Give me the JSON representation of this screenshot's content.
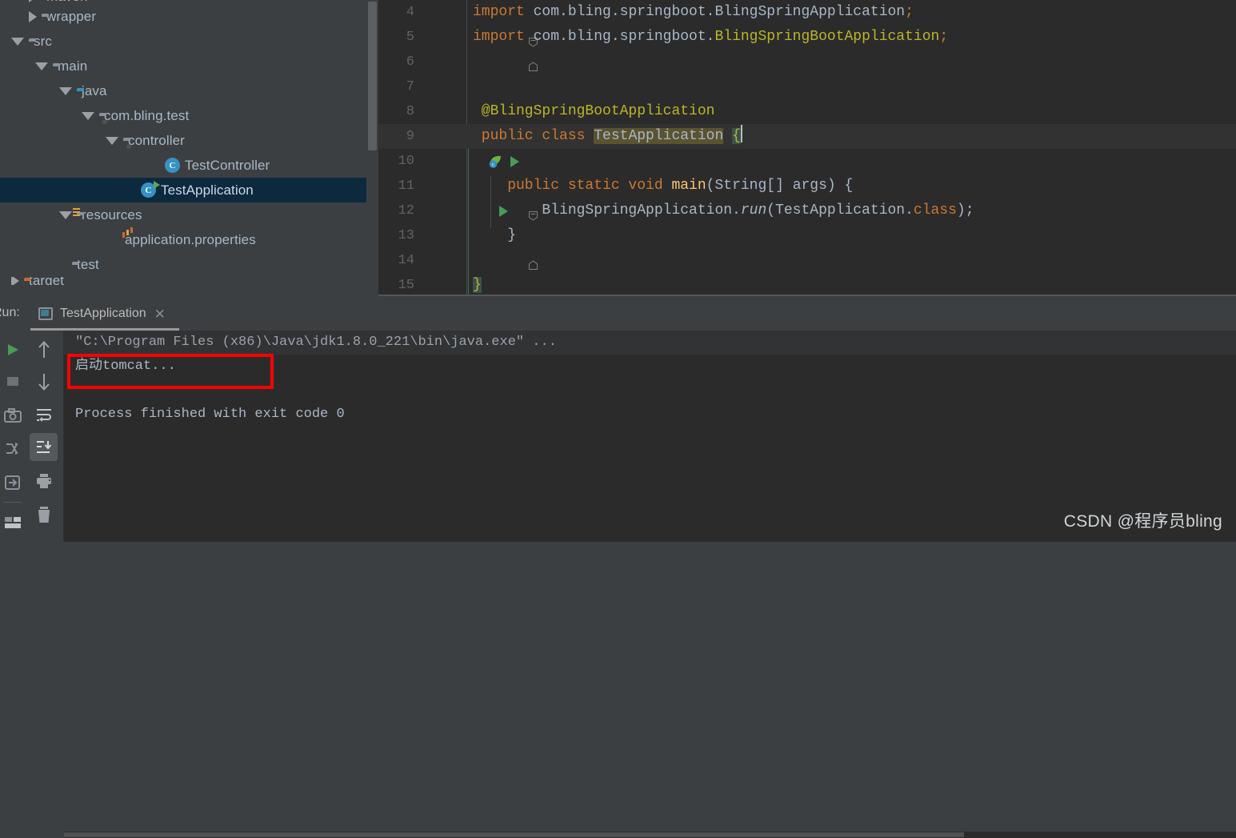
{
  "project_tree": {
    "items": [
      {
        "label": "maven",
        "indent": 1,
        "twisty": "collapsed",
        "icon": "folder",
        "selected": false,
        "partial": "top"
      },
      {
        "label": "wrapper",
        "indent": 2,
        "twisty": "collapsed",
        "icon": "folder",
        "selected": false
      },
      {
        "label": "src",
        "indent": 1,
        "twisty": "expanded",
        "icon": "folder",
        "selected": false
      },
      {
        "label": "main",
        "indent": 2,
        "twisty": "expanded",
        "icon": "folder",
        "selected": false
      },
      {
        "label": "java",
        "indent": 3,
        "twisty": "expanded",
        "icon": "folder-blue",
        "selected": false
      },
      {
        "label": "com.bling.test",
        "indent": 4,
        "twisty": "expanded",
        "icon": "folder-package",
        "selected": false
      },
      {
        "label": "controller",
        "indent": 5,
        "twisty": "expanded",
        "icon": "folder-package",
        "selected": false
      },
      {
        "label": "TestController",
        "indent": 6,
        "twisty": "none",
        "icon": "java-class",
        "selected": false
      },
      {
        "label": "TestApplication",
        "indent": 6,
        "twisty": "none",
        "icon": "java-class-runnable",
        "selected": true
      },
      {
        "label": "resources",
        "indent": 3,
        "twisty": "expanded",
        "icon": "folder-resources",
        "selected": false
      },
      {
        "label": "application.properties",
        "indent": 4,
        "twisty": "none",
        "icon": "properties-file",
        "selected": false
      },
      {
        "label": "test",
        "indent": 3,
        "twisty": "none",
        "icon": "folder",
        "selected": false
      },
      {
        "label": "target",
        "indent": 1,
        "twisty": "collapsed",
        "icon": "folder-orange",
        "selected": false,
        "partial": "bottom"
      }
    ]
  },
  "editor": {
    "lines": [
      {
        "num": "4",
        "fold": "minus",
        "gutter": "",
        "segments": [
          {
            "text": "import ",
            "style": "kw"
          },
          {
            "text": "com.bling.springboot.BlingSpringApplication",
            "style": "id"
          },
          {
            "text": ";",
            "style": "kw"
          }
        ]
      },
      {
        "num": "5",
        "fold": "end",
        "gutter": "",
        "segments": [
          {
            "text": "import ",
            "style": "kw"
          },
          {
            "text": "com.bling.springboot.",
            "style": "id"
          },
          {
            "text": "BlingSpringBootApplication",
            "style": "ann"
          },
          {
            "text": ";",
            "style": "kw"
          }
        ]
      },
      {
        "num": "6",
        "fold": "",
        "gutter": "",
        "segments": []
      },
      {
        "num": "7",
        "fold": "",
        "gutter": "",
        "segments": []
      },
      {
        "num": "8",
        "fold": "",
        "gutter": "spring-bean-icon",
        "segments": [
          {
            "text": " @BlingSpringBootApplication",
            "style": "ann"
          }
        ]
      },
      {
        "num": "9",
        "fold": "",
        "gutter": "spring-run-icons",
        "highlight": true,
        "segments": [
          {
            "text": " public class ",
            "style": "kw"
          },
          {
            "text": "TestApplication",
            "style": "ident-hl"
          },
          {
            "text": " ",
            "style": "id"
          },
          {
            "text": "{",
            "style": "brace-hl"
          }
        ]
      },
      {
        "num": "10",
        "fold": "",
        "gutter": "",
        "segments": []
      },
      {
        "num": "11",
        "fold": "minus",
        "gutter": "run-arrow",
        "segments": [
          {
            "text": "    public static void ",
            "style": "kw"
          },
          {
            "text": "main",
            "style": "mth"
          },
          {
            "text": "(String[] args) {",
            "style": "id"
          }
        ]
      },
      {
        "num": "12",
        "fold": "",
        "gutter": "",
        "segments": [
          {
            "text": "        BlingSpringApplication.",
            "style": "id"
          },
          {
            "text": "run",
            "style": "ital"
          },
          {
            "text": "(TestApplication.",
            "style": "id"
          },
          {
            "text": "class",
            "style": "kw"
          },
          {
            "text": ");",
            "style": "id"
          }
        ]
      },
      {
        "num": "13",
        "fold": "end",
        "gutter": "",
        "segments": [
          {
            "text": "    }",
            "style": "id"
          }
        ]
      },
      {
        "num": "14",
        "fold": "",
        "gutter": "",
        "segments": []
      },
      {
        "num": "15",
        "fold": "",
        "gutter": "",
        "segments": [
          {
            "text": "}",
            "style": "brace-hl-yellow"
          }
        ]
      }
    ]
  },
  "run_panel": {
    "label": "Run:",
    "tab_title": "TestApplication",
    "close_glyph": "✕",
    "toolbar_main": [
      {
        "name": "rerun-button",
        "glyph": "run-triangle"
      },
      {
        "name": "stop-button",
        "glyph": "stop-square"
      },
      {
        "name": "screenshot-button",
        "glyph": "camera"
      },
      {
        "name": "toggle-tasks-button",
        "glyph": "bug-swap"
      },
      {
        "name": "export-button",
        "glyph": "export"
      },
      {
        "name": "layout-settings-button",
        "glyph": "layout"
      }
    ],
    "toolbar_secondary": [
      {
        "name": "up-the-stack-trace-button",
        "glyph": "arrow-up",
        "active": false
      },
      {
        "name": "down-the-stack-trace-button",
        "glyph": "arrow-down",
        "active": false
      },
      {
        "name": "soft-wrap-button",
        "glyph": "soft-wrap",
        "active": false
      },
      {
        "name": "scroll-to-end-button",
        "glyph": "scroll-to-end",
        "active": true
      },
      {
        "name": "print-button",
        "glyph": "printer",
        "active": false
      },
      {
        "name": "clear-all-button",
        "glyph": "trash",
        "active": false
      }
    ],
    "console_lines": [
      {
        "text": "\"C:\\Program Files (x86)\\Java\\jdk1.8.0_221\\bin\\java.exe\" ...",
        "kind": "command"
      },
      {
        "text": "启动tomcat...",
        "kind": "output"
      },
      {
        "text": "",
        "kind": "output"
      },
      {
        "text": "Process finished with exit code 0",
        "kind": "output"
      }
    ],
    "annotation": {
      "color": "#fe0000",
      "target_line": "启动tomcat..."
    }
  },
  "watermark": {
    "text": "CSDN @程序员bling"
  },
  "colors": {
    "ide_chrome": "#3c3f41",
    "editor_bg": "#2b2b2b",
    "console_bg": "#2b2b2b",
    "selection_bg": "#0d293e",
    "text": "#a9b7c6",
    "keyword": "#cc7832",
    "annotation": "#bbb529",
    "method": "#ffc66d",
    "line_number": "#606366",
    "annotation_box": "#fe0000",
    "run_green": "#59a869"
  }
}
